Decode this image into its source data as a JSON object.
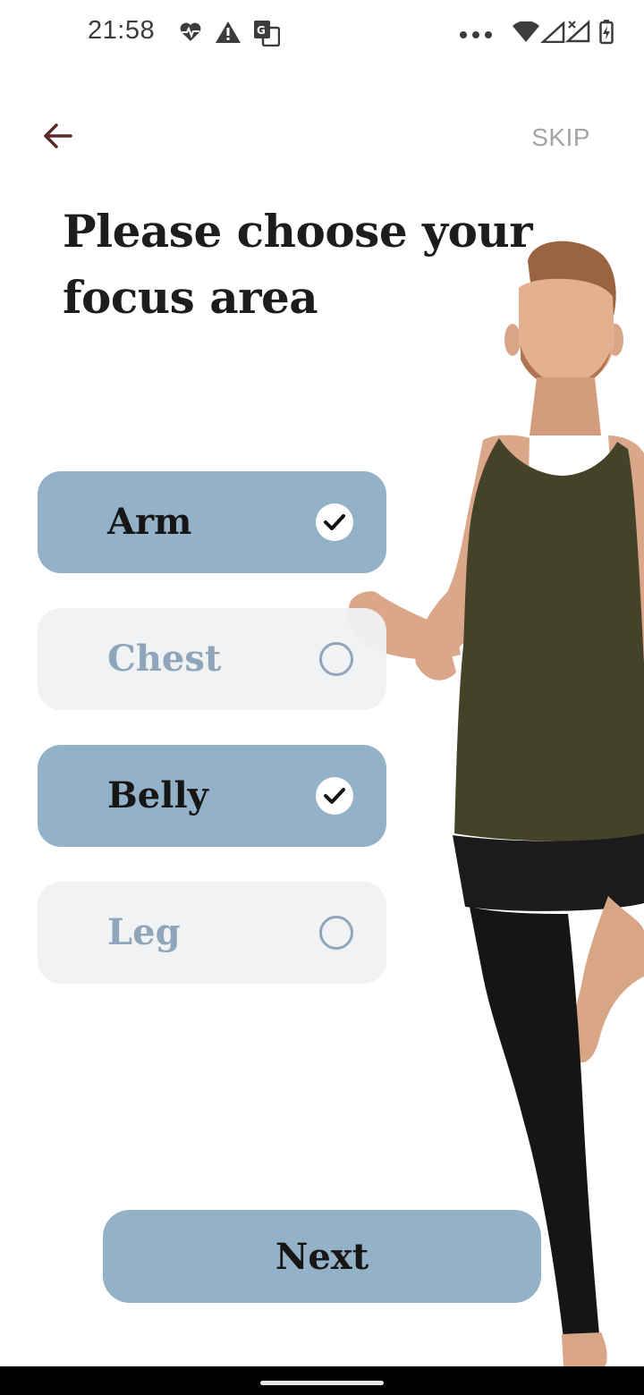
{
  "status_bar": {
    "time": "21:58",
    "left_icons": [
      "heart-pulse-icon",
      "warning-icon",
      "translate-icon"
    ],
    "right_icons": [
      "more-dots-icon",
      "wifi-icon",
      "signal-icon",
      "signal-x-icon",
      "battery-charging-icon"
    ]
  },
  "header": {
    "back_icon": "arrow-left-icon",
    "skip_label": "SKIP"
  },
  "title": "Please choose your focus area",
  "options": [
    {
      "label": "Arm",
      "selected": true
    },
    {
      "label": "Chest",
      "selected": false
    },
    {
      "label": "Belly",
      "selected": true
    },
    {
      "label": "Leg",
      "selected": false
    }
  ],
  "next_label": "Next",
  "colors": {
    "accent": "#93b2c8",
    "unselected_bg": "#eff1f3",
    "unselected_text": "#8fa5ba",
    "back_arrow": "#5a2a2a",
    "skip_text": "#a4a4a4"
  }
}
